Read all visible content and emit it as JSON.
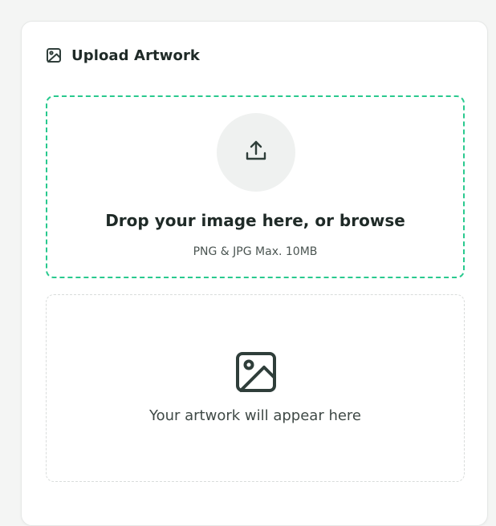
{
  "header": {
    "icon": "image-icon",
    "title": "Upload Artwork"
  },
  "dropzone": {
    "icon": "upload-icon",
    "title": "Drop your image here, or browse",
    "subtitle": "PNG & JPG Max. 10MB",
    "border_color": "#29c98e"
  },
  "preview": {
    "icon": "image-placeholder-icon",
    "text": "Your artwork will appear here"
  },
  "colors": {
    "text_primary": "#1f2a27",
    "text_muted": "#4b5552",
    "icon_dark": "#2f3e3a",
    "circle_bg": "#eff1f0",
    "card_bg": "#ffffff",
    "page_bg": "#f4f5f4"
  }
}
